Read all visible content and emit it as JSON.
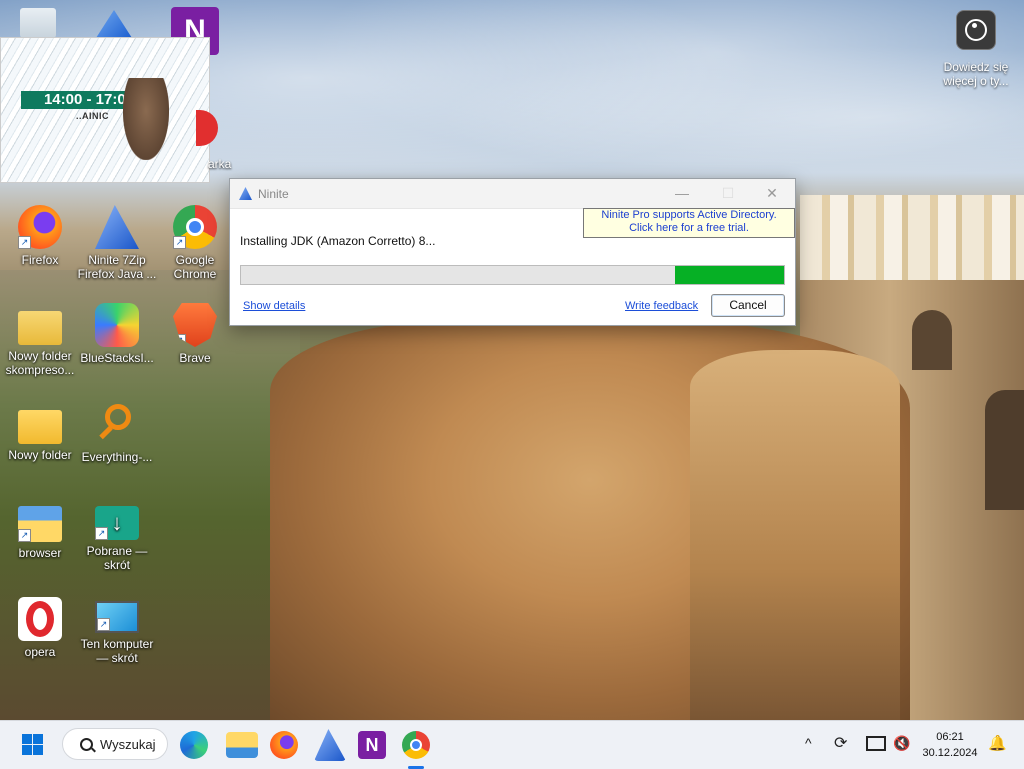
{
  "desktop": {
    "widget": {
      "time": "14:00 - 17:00",
      "subtitle": "..AINIC"
    },
    "top_app_letter": "N",
    "partial_label": "arka",
    "icons": [
      {
        "label": "Firefox"
      },
      {
        "label": "Ninite 7Zip Firefox Java ..."
      },
      {
        "label": "Google Chrome"
      },
      {
        "label": "Nowy folder skompreso..."
      },
      {
        "label": "BlueStacksI..."
      },
      {
        "label": "Brave"
      },
      {
        "label": "Nowy folder"
      },
      {
        "label": "Everything-..."
      },
      {
        "label": "browser"
      },
      {
        "label": "Pobrane — skrót"
      },
      {
        "label": "opera"
      },
      {
        "label": "Ten komputer — skrót"
      }
    ],
    "learn_more": "Dowiedz się więcej o ty..."
  },
  "dialog": {
    "title": "Ninite",
    "minimize": "—",
    "maximize": "☐",
    "close": "✕",
    "promo_line1": "Ninite Pro supports Active Directory.",
    "promo_line2": "Click here for a free trial.",
    "status": "Installing JDK (Amazon Corretto) 8...",
    "progress_percent": 20,
    "show_details": "Show details",
    "write_feedback": "Write feedback",
    "cancel": "Cancel"
  },
  "taskbar": {
    "search_label": "Wyszukaj",
    "apps": [
      "edge-icon",
      "file-explorer-icon",
      "firefox-icon",
      "ninite-icon",
      "app-n-icon",
      "chrome-icon"
    ],
    "active_app": "chrome-icon",
    "tray_chevron": "^",
    "time": "06:21",
    "date": "30.12.2024"
  },
  "colors": {
    "accent": "#06b025",
    "link": "#1c4ed8",
    "promo_bg": "#ffffe1"
  }
}
